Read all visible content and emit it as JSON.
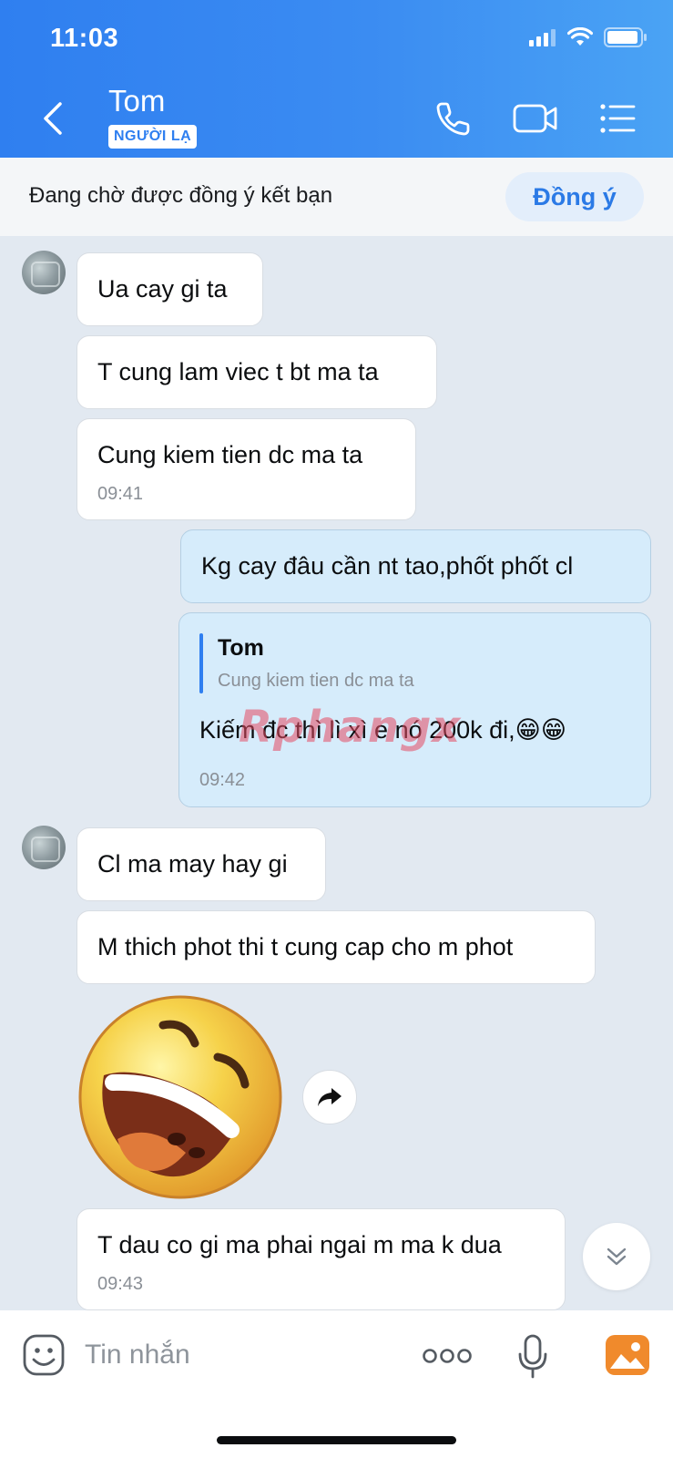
{
  "status_bar": {
    "time": "11:03"
  },
  "header": {
    "contact_name": "Tom",
    "badge": "NGƯỜI LẠ"
  },
  "friend_request": {
    "text": "Đang chờ được đồng ý kết bạn",
    "agree_label": "Đồng ý"
  },
  "messages": [
    {
      "from": "them",
      "text": "Ua cay gi ta"
    },
    {
      "from": "them",
      "text": "T cung lam viec t bt ma ta"
    },
    {
      "from": "them",
      "text": "Cung kiem tien dc ma ta",
      "time": "09:41"
    },
    {
      "from": "me",
      "text": "Kg cay đâu cần nt tao,phốt phốt cl"
    },
    {
      "from": "me",
      "quote_name": "Tom",
      "quote_text": "Cung kiem tien dc ma ta",
      "text": "Kiếm đc thì lì xì e nó 200k đi,😁😁",
      "time": "09:42"
    },
    {
      "from": "them",
      "text": "Cl ma may hay gi"
    },
    {
      "from": "them",
      "text": "M thich phot thi t cung cap cho m phot"
    },
    {
      "from": "them",
      "type": "sticker",
      "sticker": "laughing-face-sticker"
    },
    {
      "from": "them",
      "text": "T dau co gi ma phai ngai m ma k dua",
      "time": "09:43"
    }
  ],
  "watermark": "Rphangx",
  "input": {
    "placeholder": "Tin nhắn"
  },
  "colors": {
    "header_blue": "#2f7ff0",
    "my_bubble": "#d6ecfb",
    "chat_bg": "#e2e9f1"
  }
}
